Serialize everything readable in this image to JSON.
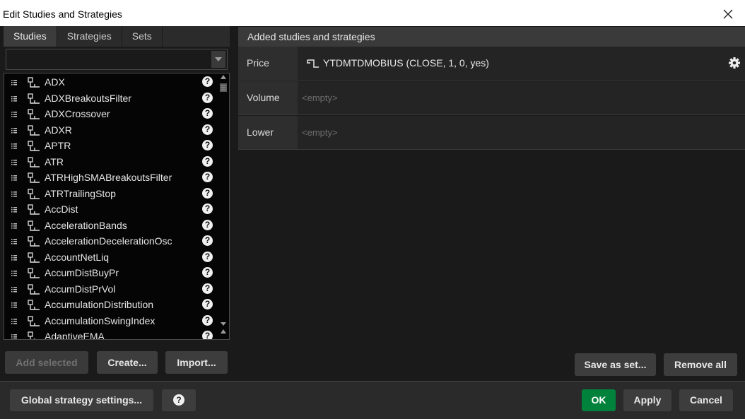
{
  "window": {
    "title": "Edit Studies and Strategies"
  },
  "tabs": [
    "Studies",
    "Strategies",
    "Sets"
  ],
  "search": {
    "value": "",
    "placeholder": ""
  },
  "studies": [
    "ADX",
    "ADXBreakoutsFilter",
    "ADXCrossover",
    "ADXR",
    "APTR",
    "ATR",
    "ATRHighSMABreakoutsFilter",
    "ATRTrailingStop",
    "AccDist",
    "AccelerationBands",
    "AccelerationDecelerationOsc",
    "AccountNetLiq",
    "AccumDistBuyPr",
    "AccumDistPrVol",
    "AccumulationDistribution",
    "AccumulationSwingIndex",
    "AdaptiveEMA"
  ],
  "left_buttons": {
    "add_selected": "Add selected",
    "create": "Create...",
    "import": "Import..."
  },
  "added": {
    "header": "Added studies and strategies",
    "panes": [
      {
        "label": "Price",
        "value": "YTDMTDMOBIUS (CLOSE, 1, 0, yes)",
        "empty": false
      },
      {
        "label": "Volume",
        "value": "<empty>",
        "empty": true
      },
      {
        "label": "Lower",
        "value": "<empty>",
        "empty": true
      }
    ]
  },
  "right_buttons": {
    "save_as_set": "Save as set...",
    "remove_all": "Remove all"
  },
  "footer": {
    "global_settings": "Global strategy settings...",
    "help": "?",
    "ok": "OK",
    "apply": "Apply",
    "cancel": "Cancel"
  },
  "colors": {
    "ok_green": "#00823c",
    "panel": "#1a1a1a",
    "list_bg": "#050505"
  },
  "icons": {
    "close": "close-icon",
    "dropdown": "chevron-down-icon",
    "drag": "drag-handle-icon",
    "study": "study-script-icon",
    "help": "question-icon",
    "gear": "gear-icon"
  }
}
